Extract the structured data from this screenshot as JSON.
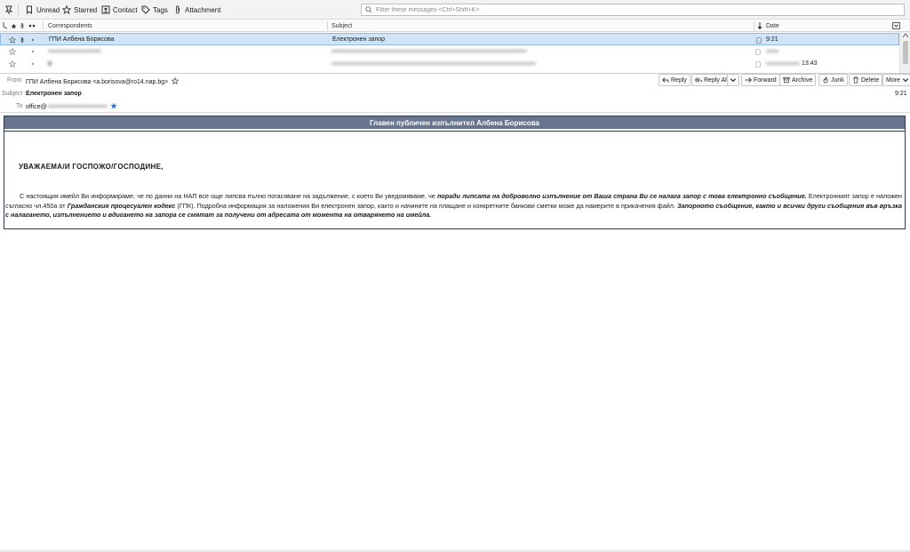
{
  "toolbar": {
    "unread": "Unread",
    "starred": "Starred",
    "contact": "Contact",
    "tags": "Tags",
    "attachment": "Attachment",
    "filter_placeholder": "Filter these messages <Ctrl+Shift+K>"
  },
  "thread_columns": {
    "correspondents": "Correspondents",
    "subject": "Subject",
    "date": "Date"
  },
  "thread_rows": [
    {
      "correspondent": "ГПИ Албена Борисова",
      "subject": "Електронен запор",
      "date": "9:21",
      "selected": true
    },
    {
      "correspondent": "",
      "subject": "",
      "date": "",
      "selected": false
    },
    {
      "correspondent": "",
      "subject": "",
      "date": "13:43",
      "selected": false
    }
  ],
  "message_header": {
    "from_label": "From",
    "from_value": "ГПИ Албена Борисова <a.borisova@ro14.nap.bg>",
    "subject_label": "Subject",
    "subject_value": "Електронен запор",
    "to_label": "To",
    "to_value": "office@",
    "time": "9:21"
  },
  "message_actions": {
    "reply": "Reply",
    "reply_all": "Reply All",
    "forward": "Forward",
    "archive": "Archive",
    "junk": "Junk",
    "delete": "Delete",
    "more": "More"
  },
  "email": {
    "banner": "Главен публичен изпълнител Албена Борисова",
    "salutation": "УВАЖАЕМА/И ГОСПОЖО/ГОСПОДИНЕ,",
    "p1": "С настоящия имейл Ви информираме, че по данни на НАП все още липсва пълно погасяване на задължение, с което Ви уведомяваме, че ",
    "p1_bold": "поради липсата на доброволно изпълнение от Ваша страна Ви се налага запор с това електронно съобщение.",
    "p2": " Електронният запор е наложен съгласно чл.450а от ",
    "p2_bold": "Гражданския процесуален кодекс",
    "p3": " (ГПК). Подробна информация за наложения Ви електронен запор, както и начините на плащане и конкретните банкови сметки може да намерите в прикачения файл. ",
    "p3_bold": "Запорното съобщение, както и всички други съобщения във връзка с налагането, изпълнението и вдигането на запора се смятат за получени от адресата от момента на отварянето на имейла."
  }
}
